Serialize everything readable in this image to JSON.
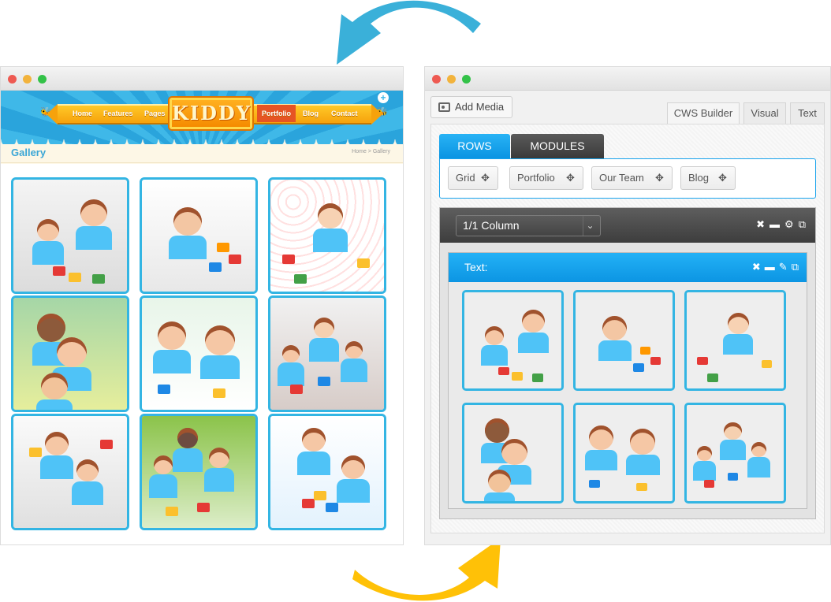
{
  "site": {
    "logo": "KIDDY",
    "nav": [
      "Home",
      "Features",
      "Pages",
      "Portfolio",
      "Blog",
      "Contact"
    ],
    "active_nav": "Portfolio",
    "page_title": "Gallery",
    "breadcrumb": "Home  >  Gallery"
  },
  "builder": {
    "add_media_label": "Add Media",
    "editor_tabs": [
      "CWS Builder",
      "Visual",
      "Text"
    ],
    "rows_tab": "ROWS",
    "modules_tab": "MODULES",
    "row_buttons": [
      "Grid",
      "Portfolio",
      "Our Team",
      "Blog"
    ],
    "column_select": "1/1 Column",
    "text_module_label": "Text:"
  },
  "colors": {
    "accent_blue": "#19a3ec",
    "photo_border": "#33b5e3",
    "arrow_blue": "#3ab0d9",
    "arrow_yellow": "#ffc107",
    "nav_orange": "#f6a20c"
  }
}
